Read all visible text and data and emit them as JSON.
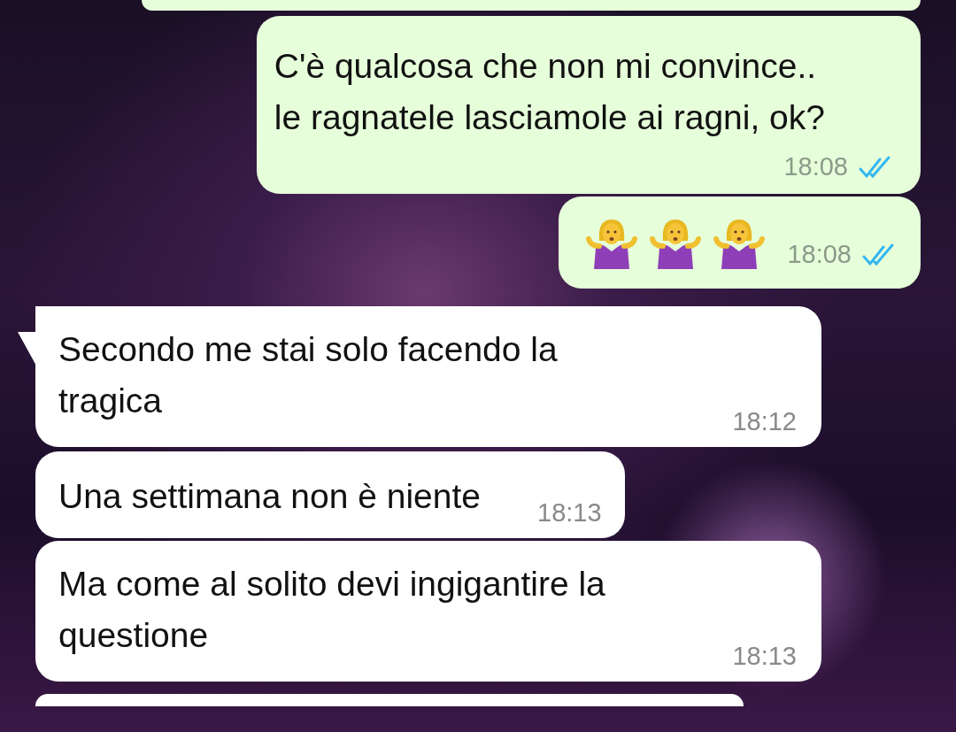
{
  "messages": [
    {
      "kind": "text",
      "outgoing": true,
      "text": "C'è qualcosa che non mi convince..\nle ragnatele lasciamole ai ragni, ok?",
      "time": "18:08",
      "read": true,
      "tail": false
    },
    {
      "kind": "emoji",
      "outgoing": true,
      "emojis": [
        {
          "kind": "shrug"
        },
        {
          "kind": "shrug"
        },
        {
          "kind": "shrug"
        }
      ],
      "time": "18:08",
      "read": true,
      "tail": false
    },
    {
      "kind": "text",
      "outgoing": false,
      "text": "Secondo me stai solo facendo la\ntragica",
      "time": "18:12",
      "tail": true
    },
    {
      "kind": "text",
      "outgoing": false,
      "text": "Una settimana non è niente",
      "time": "18:13",
      "tail": false
    },
    {
      "kind": "text",
      "outgoing": false,
      "text": "Ma come al solito devi ingigantire la\nquestione",
      "time": "18:13",
      "tail": false
    }
  ]
}
